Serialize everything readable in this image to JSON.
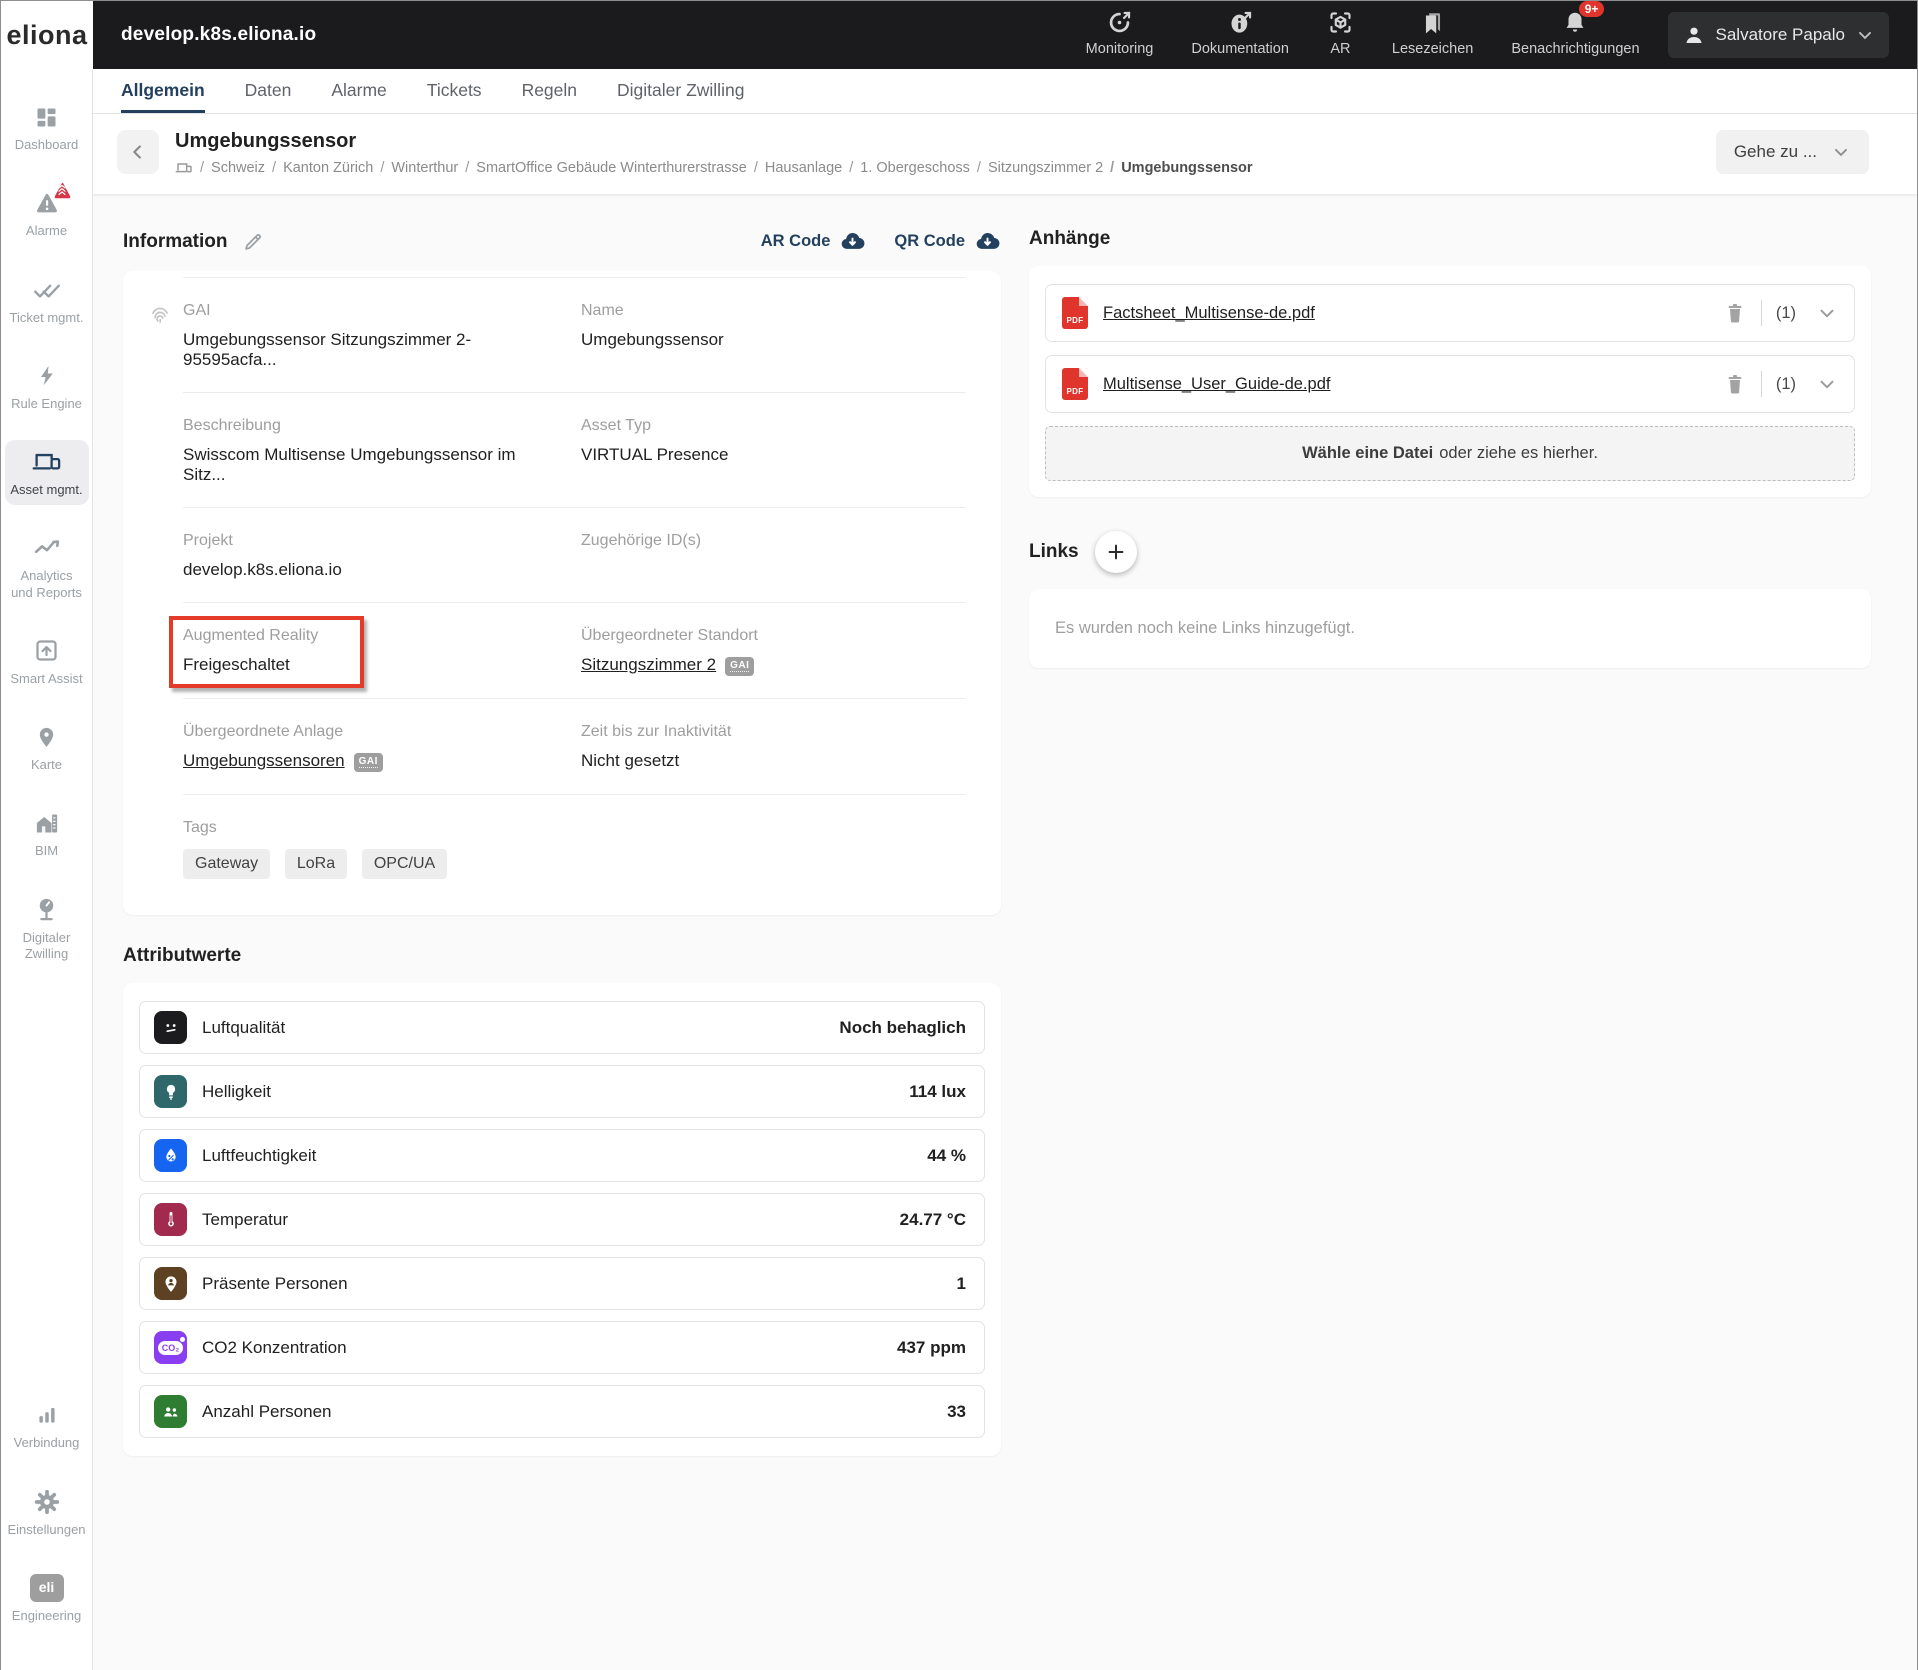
{
  "topbar": {
    "logo": "eliona",
    "environment": "develop.k8s.eliona.io",
    "actions": [
      {
        "label": "Monitoring"
      },
      {
        "label": "Dokumentation"
      },
      {
        "label": "AR"
      },
      {
        "label": "Lesezeichen"
      },
      {
        "label": "Benachrichtigungen",
        "badge": "9+"
      }
    ],
    "user": {
      "name": "Salvatore Papalo"
    }
  },
  "sidebar": {
    "items": [
      {
        "label": "Dashboard"
      },
      {
        "label": "Alarme"
      },
      {
        "label": "Ticket mgmt."
      },
      {
        "label": "Rule Engine"
      },
      {
        "label": "Asset mgmt."
      },
      {
        "label": "Analytics und Reports"
      },
      {
        "label": "Smart Assist"
      },
      {
        "label": "Karte"
      },
      {
        "label": "BIM"
      },
      {
        "label": "Digitaler Zwilling"
      }
    ],
    "bottom_items": [
      {
        "label": "Verbindung"
      },
      {
        "label": "Einstellungen"
      },
      {
        "label": "Engineering",
        "icon_text": "eli"
      }
    ]
  },
  "tabs": [
    {
      "label": "Allgemein"
    },
    {
      "label": "Daten"
    },
    {
      "label": "Alarme"
    },
    {
      "label": "Tickets"
    },
    {
      "label": "Regeln"
    },
    {
      "label": "Digitaler Zwilling"
    }
  ],
  "page": {
    "title": "Umgebungssensor",
    "breadcrumb": [
      "Schweiz",
      "Kanton Zürich",
      "Winterthur",
      "SmartOffice Gebäude Winterthurerstrasse",
      "Hausanlage",
      "1. Obergeschoss",
      "Sitzungszimmer 2",
      "Umgebungssensor"
    ],
    "goto_label": "Gehe zu ..."
  },
  "information": {
    "heading": "Information",
    "ar_code_label": "AR Code",
    "qr_code_label": "QR Code",
    "fields": {
      "gai": {
        "label": "GAI",
        "value": "Umgebungssensor Sitzungszimmer 2-95595acfa..."
      },
      "name": {
        "label": "Name",
        "value": "Umgebungssensor"
      },
      "beschreibung": {
        "label": "Beschreibung",
        "value": "Swisscom Multisense Umgebungssensor im Sitz..."
      },
      "asset_typ": {
        "label": "Asset Typ",
        "value": "VIRTUAL Presence"
      },
      "projekt": {
        "label": "Projekt",
        "value": "develop.k8s.eliona.io"
      },
      "zugehoerige_ids": {
        "label": "Zugehörige ID(s)",
        "value": ""
      },
      "augmented_reality": {
        "label": "Augmented Reality",
        "value": "Freigeschaltet"
      },
      "standort": {
        "label": "Übergeordneter Standort",
        "value": "Sitzungszimmer 2",
        "badge": "GAI"
      },
      "anlage": {
        "label": "Übergeordnete Anlage",
        "value": "Umgebungssensoren",
        "badge": "GAI"
      },
      "inaktivitaet": {
        "label": "Zeit bis zur Inaktivität",
        "value": "Nicht gesetzt"
      },
      "tags": {
        "label": "Tags",
        "values": [
          "Gateway",
          "LoRa",
          "OPC/UA"
        ]
      }
    }
  },
  "attachments": {
    "heading": "Anhänge",
    "pdf_badge": "PDF",
    "files": [
      {
        "name": "Factsheet_Multisense-de.pdf",
        "count": "(1)"
      },
      {
        "name": "Multisense_User_Guide-de.pdf",
        "count": "(1)"
      }
    ],
    "upload_bold": "Wähle eine Datei",
    "upload_rest": "oder ziehe es hierher."
  },
  "links": {
    "heading": "Links",
    "empty_text": "Es wurden noch keine Links hinzugefügt."
  },
  "attributes": {
    "heading": "Attributwerte",
    "rows": [
      {
        "label": "Luftqualität",
        "value": "Noch behaglich",
        "color": "#1c1c1e"
      },
      {
        "label": "Helligkeit",
        "value": "114 lux",
        "color": "#2f686a"
      },
      {
        "label": "Luftfeuchtigkeit",
        "value": "44 %",
        "color": "#1565f0"
      },
      {
        "label": "Temperatur",
        "value": "24.77 °C",
        "color": "#a12a4e"
      },
      {
        "label": "Präsente Personen",
        "value": "1",
        "color": "#5d4122"
      },
      {
        "label": "CO2 Konzentration",
        "value": "437 ppm",
        "color": "#8a3ef2",
        "icon_text": "CO₂"
      },
      {
        "label": "Anzahl Personen",
        "value": "33",
        "color": "#2e7d32"
      }
    ]
  },
  "colors": {
    "accent_navy": "#23405e",
    "alert_red": "#e0352c",
    "annotation_red": "#e33a29"
  }
}
